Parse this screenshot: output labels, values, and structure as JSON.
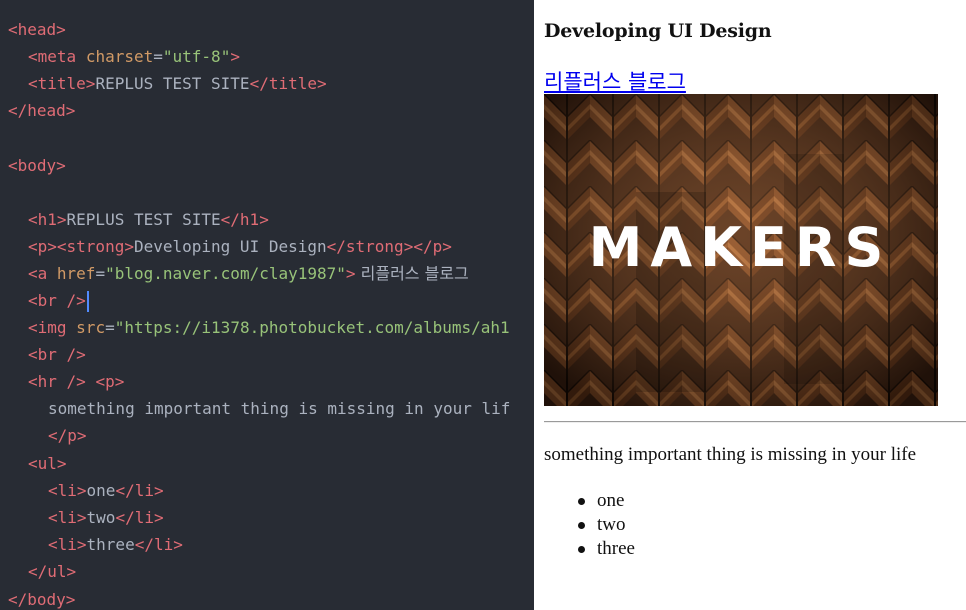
{
  "editor": {
    "meta_charset_value": "\"utf-8\"",
    "title_text": "REPLUS TEST SITE",
    "h1_text": "REPLUS TEST SITE",
    "strong_text": "Developing UI Design",
    "href_value": "\"blog.naver.com/clay1987\"",
    "link_text": " 리플러스 블로그 ",
    "img_src_value": "\"https://i1378.photobucket.com/albums/ah1",
    "p_text": "something important thing is missing in your lif",
    "li_items": [
      "one",
      "two",
      "three"
    ]
  },
  "preview": {
    "strong_text": "Developing UI Design",
    "link_text": "리플러스 블로그 ",
    "image_word": "MAKERS",
    "paragraph": "something important thing is missing in your life",
    "list": [
      "one",
      "two",
      "three"
    ]
  }
}
